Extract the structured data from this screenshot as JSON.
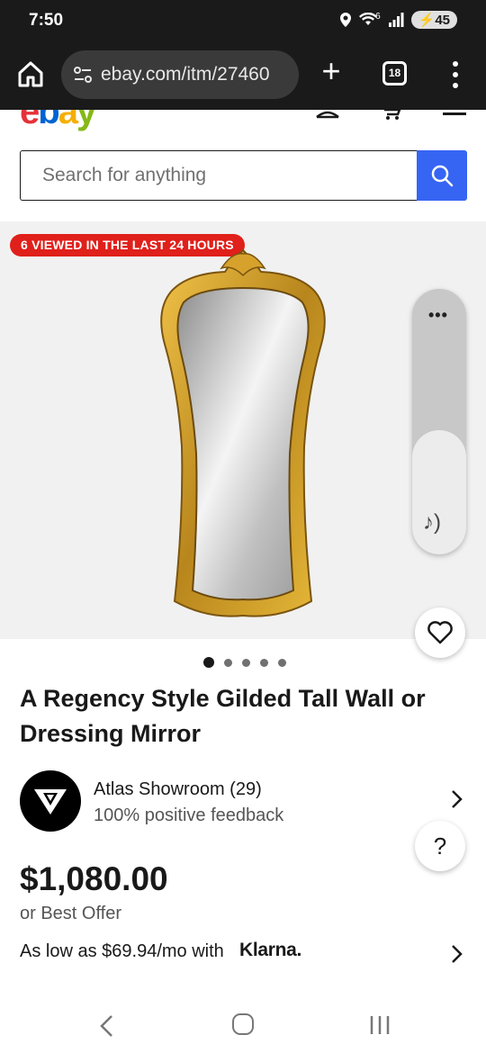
{
  "status_bar": {
    "time": "7:50",
    "battery": "45",
    "signal_badge": "6"
  },
  "browser": {
    "url": "ebay.com/itm/27460",
    "tab_count": "18"
  },
  "search": {
    "placeholder": "Search for anything"
  },
  "product": {
    "viewed_badge": "6 VIEWED IN THE LAST 24 HOURS",
    "title": "A Regency Style Gilded Tall Wall or Dressing Mirror",
    "image_count": 5,
    "active_image": 0
  },
  "seller": {
    "name": "Atlas Showroom (29)",
    "feedback": "100% positive feedback"
  },
  "pricing": {
    "price": "$1,080.00",
    "best_offer": "or Best Offer",
    "installment_text": "As low as $69.94/mo with",
    "klarna_brand": "Klarna."
  },
  "help": {
    "label": "?"
  },
  "icons": [
    "home-icon",
    "site-settings-icon",
    "plus-icon",
    "tabs-icon",
    "more-vert-icon",
    "search-icon",
    "heart-icon",
    "chevron-right-icon",
    "back-icon",
    "home-nav-icon",
    "recents-icon"
  ],
  "colors": {
    "primary": "#3665f3",
    "badge": "#e0201a",
    "browser_bg": "#1a1a1a"
  }
}
